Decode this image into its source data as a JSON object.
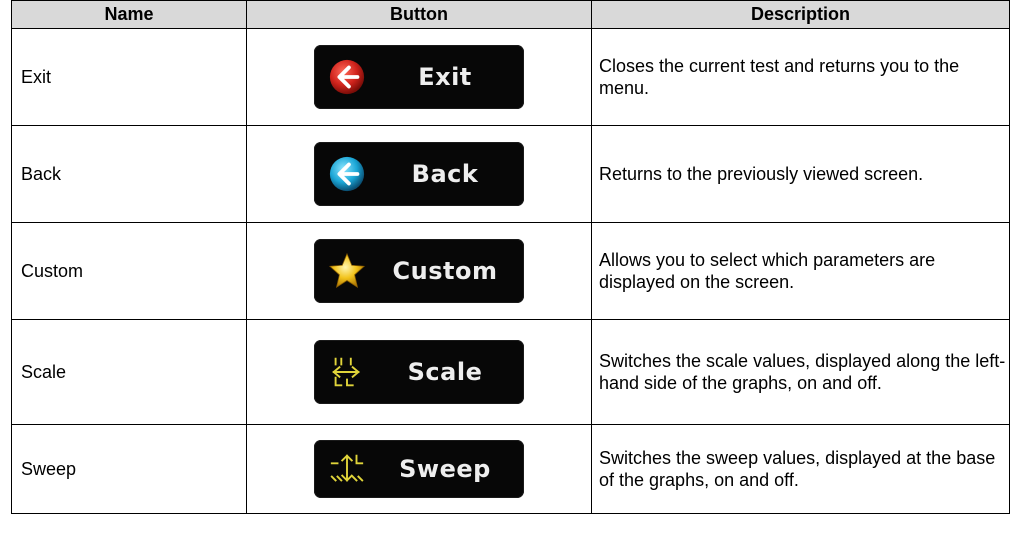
{
  "table": {
    "headers": {
      "name": "Name",
      "button": "Button",
      "description": "Description"
    },
    "rows": [
      {
        "name": "Exit",
        "button_label": "Exit",
        "icon": "exit-arrow-red-icon",
        "description": "Closes the current test and returns you to the menu."
      },
      {
        "name": "Back",
        "button_label": "Back",
        "icon": "back-arrow-blue-icon",
        "description": "Returns to the previously viewed screen."
      },
      {
        "name": "Custom",
        "button_label": "Custom",
        "icon": "star-icon",
        "description": "Allows you to select which parameters are displayed on the screen."
      },
      {
        "name": "Scale",
        "button_label": "Scale",
        "icon": "scale-icon",
        "description": "Switches the scale values, displayed along the left-hand side of the graphs, on and off."
      },
      {
        "name": "Sweep",
        "button_label": "Sweep",
        "icon": "sweep-icon",
        "description": "Switches the sweep values, displayed at the base of the graphs, on and off."
      }
    ]
  },
  "colors": {
    "header_bg": "#d9d9d9",
    "button_bg": "#070707",
    "exit_icon": "#d0231c",
    "back_icon": "#1aa6d6",
    "star_icon": "#f2c31b",
    "scale_icon": "#e0d43a"
  }
}
